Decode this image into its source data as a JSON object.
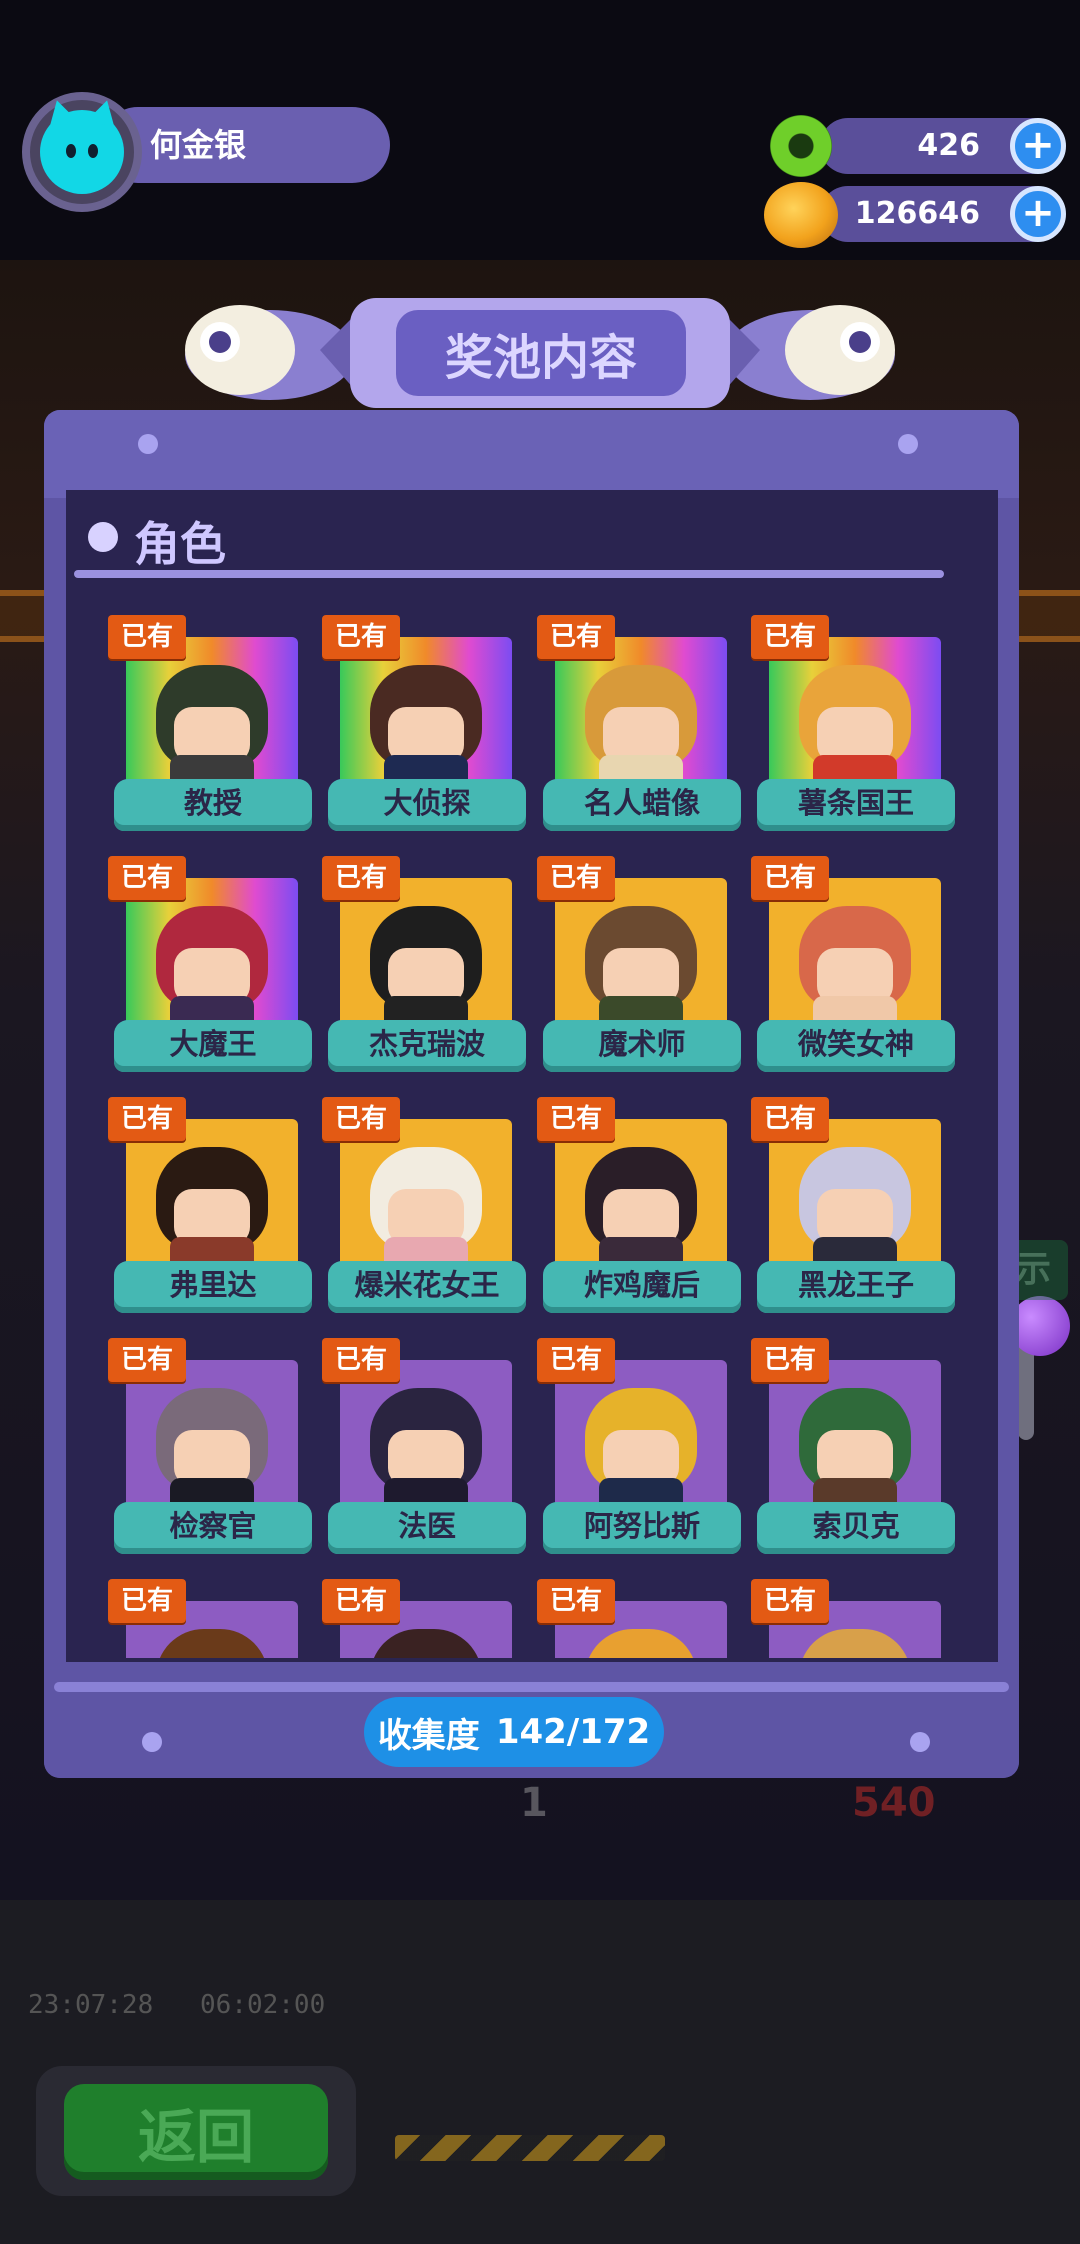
{
  "player": {
    "name": "何金银"
  },
  "currencies": [
    {
      "name": "green-donut-coin",
      "value": "426",
      "color": "#6fcf2a"
    },
    {
      "name": "gold-planet-coin",
      "value": "126646",
      "color": "#f2a21c"
    }
  ],
  "modal": {
    "title": "奖池内容",
    "section_title": "角色",
    "owned_label": "已有",
    "progress_label": "收集度",
    "progress_value": "142/172"
  },
  "characters": [
    {
      "name": "教授",
      "frame": "rainbow",
      "hair": "#2e3b2a",
      "outfit": "#3b3b3b"
    },
    {
      "name": "大侦探",
      "frame": "rainbow",
      "hair": "#4a2a22",
      "outfit": "#1e2a52"
    },
    {
      "name": "名人蜡像",
      "frame": "rainbow",
      "hair": "#d89a3a",
      "outfit": "#e8d6b0"
    },
    {
      "name": "薯条国王",
      "frame": "rainbow",
      "hair": "#e9a43a",
      "outfit": "#d23a2a"
    },
    {
      "name": "大魔王",
      "frame": "rainbow",
      "hair": "#b0283e",
      "outfit": "#3a2a52"
    },
    {
      "name": "杰克瑞波",
      "frame": "gold",
      "hair": "#1e1e1e",
      "outfit": "#222222"
    },
    {
      "name": "魔术师",
      "frame": "gold",
      "hair": "#6b4a30",
      "outfit": "#3b4a2a"
    },
    {
      "name": "微笑女神",
      "frame": "gold",
      "hair": "#d8684a",
      "outfit": "#f0c8a8"
    },
    {
      "name": "弗里达",
      "frame": "gold",
      "hair": "#2a1a12",
      "outfit": "#8a3a2a"
    },
    {
      "name": "爆米花女王",
      "frame": "gold",
      "hair": "#f2ece0",
      "outfit": "#e8a8b0"
    },
    {
      "name": "炸鸡魔后",
      "frame": "gold",
      "hair": "#2a1e28",
      "outfit": "#3a2a3a"
    },
    {
      "name": "黑龙王子",
      "frame": "gold",
      "hair": "#c8c6e0",
      "outfit": "#2a2a3a"
    },
    {
      "name": "检察官",
      "frame": "purple",
      "hair": "#7a6a7a",
      "outfit": "#1a1a24"
    },
    {
      "name": "法医",
      "frame": "purple",
      "hair": "#2a2440",
      "outfit": "#1e1a2e"
    },
    {
      "name": "阿努比斯",
      "frame": "purple",
      "hair": "#e6b22a",
      "outfit": "#1e2a4a"
    },
    {
      "name": "索贝克",
      "frame": "purple",
      "hair": "#2f6a3a",
      "outfit": "#5a3a2a"
    },
    {
      "name": "",
      "frame": "purple",
      "hair": "#6a3a1a",
      "outfit": "#3a2a1a"
    },
    {
      "name": "",
      "frame": "purple",
      "hair": "#3a2222",
      "outfit": "#2a1a1a"
    },
    {
      "name": "",
      "frame": "purple",
      "hair": "#e8a030",
      "outfit": "#3a2a1a"
    },
    {
      "name": "",
      "frame": "purple",
      "hair": "#d8a04a",
      "outfit": "#3a2a1a"
    }
  ],
  "background": {
    "timer_left": "23:07:28",
    "timer_right": "06:02:00",
    "coin_count_left": "1",
    "coin_count_right": "540",
    "hint_glyph": "示"
  },
  "back_button": {
    "label": "返回"
  }
}
